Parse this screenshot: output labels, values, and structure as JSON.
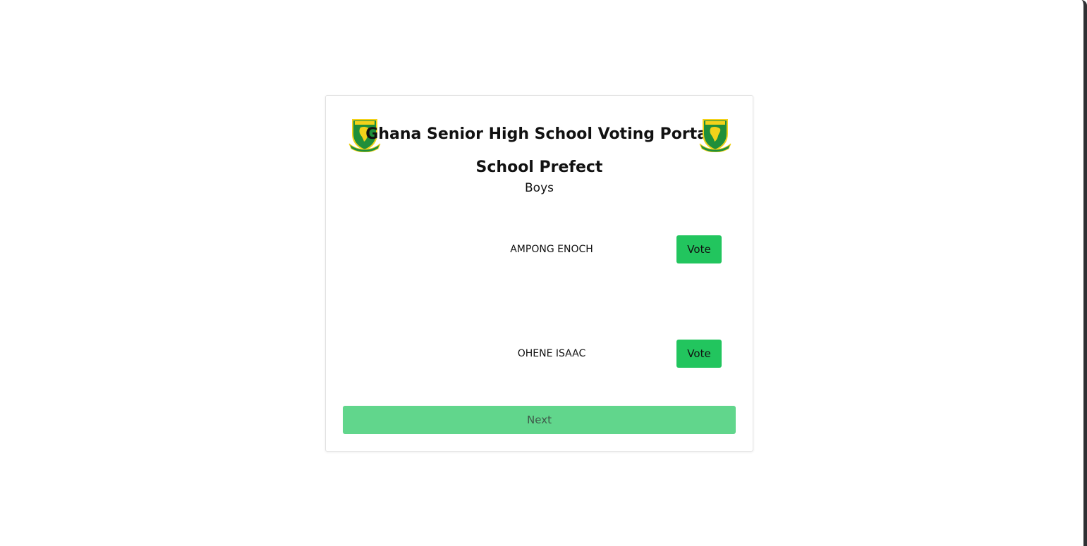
{
  "portal": {
    "title": "Ghana Senior High School Voting Portal"
  },
  "ballot": {
    "position": "School Prefect",
    "category": "Boys"
  },
  "candidates": [
    {
      "name": "AMPONG ENOCH",
      "vote_label": "Vote"
    },
    {
      "name": "OHENE ISAAC",
      "vote_label": "Vote"
    }
  ],
  "actions": {
    "next_label": "Next"
  },
  "icons": {
    "logo": "school-crest-icon"
  },
  "colors": {
    "vote_button": "#22c55e",
    "next_button_disabled": "#61d68c",
    "crest_green": "#1f8f3a",
    "crest_yellow": "#f2d21a"
  }
}
